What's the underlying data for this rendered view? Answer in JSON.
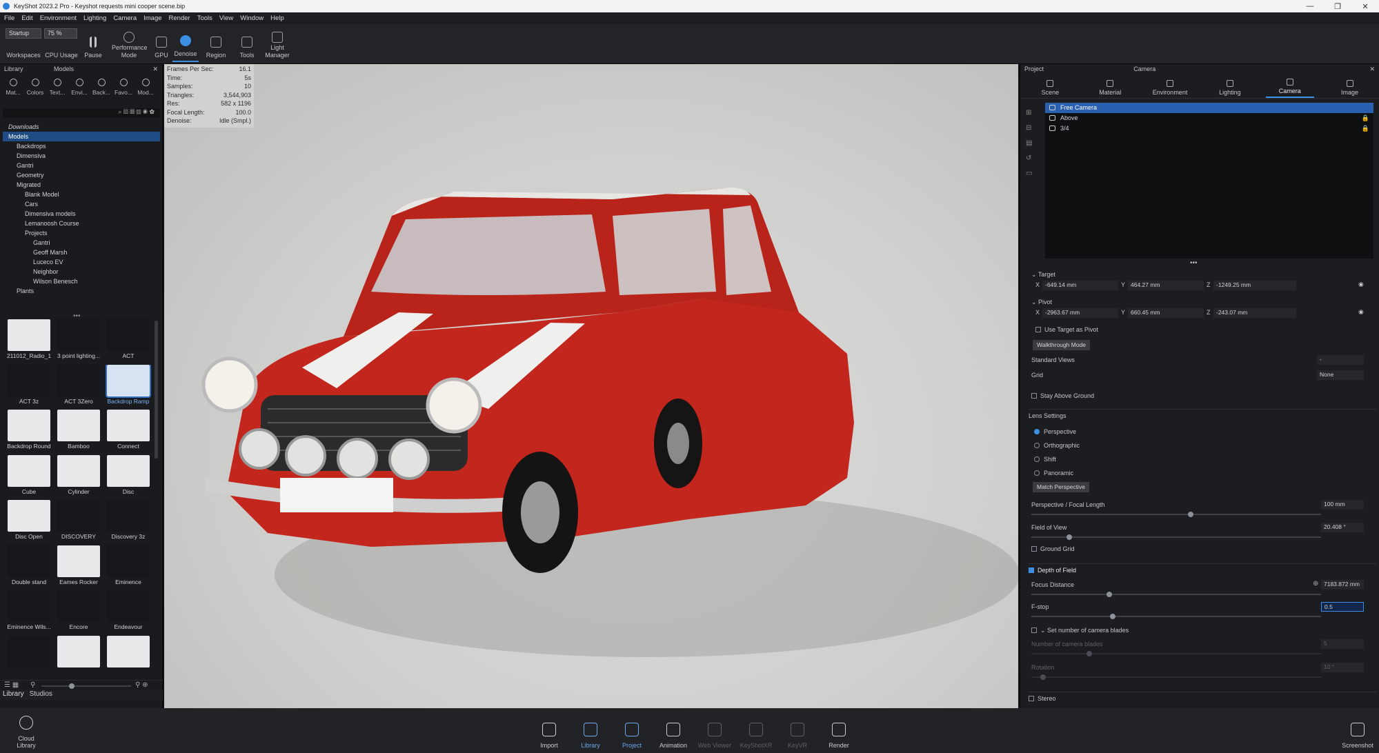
{
  "window": {
    "title": "KeyShot 2023.2 Pro - Keyshot requests mini cooper scene.bip",
    "min": "—",
    "max": "❐",
    "close": "✕"
  },
  "menu": [
    "File",
    "Edit",
    "Environment",
    "Lighting",
    "Camera",
    "Image",
    "Render",
    "Tools",
    "View",
    "Window",
    "Help"
  ],
  "toolbar": {
    "workspace_value": "Startup",
    "cpu_value": "75 %",
    "items": [
      "Workspaces",
      "CPU Usage",
      "Pause",
      "Performance Mode",
      "GPU",
      "Denoise",
      "Region",
      "Tools",
      "Light Manager"
    ]
  },
  "library": {
    "header_left": "Library",
    "header_center": "Models",
    "categories": [
      "Mat...",
      "Colors",
      "Text...",
      "Envi...",
      "Back...",
      "Favo...",
      "Mod..."
    ],
    "tree": [
      {
        "label": "Downloads",
        "indent": 0
      },
      {
        "label": "Models",
        "indent": 0,
        "hl": true
      },
      {
        "label": "Backdrops",
        "indent": 1
      },
      {
        "label": "Dimensiva",
        "indent": 1
      },
      {
        "label": "Gantri",
        "indent": 1
      },
      {
        "label": "Geometry",
        "indent": 1
      },
      {
        "label": "Migrated",
        "indent": 1
      },
      {
        "label": "Blank Model",
        "indent": 2
      },
      {
        "label": "Cars",
        "indent": 2
      },
      {
        "label": "Dimensiva models",
        "indent": 2
      },
      {
        "label": "Lemanoosh Course",
        "indent": 2
      },
      {
        "label": "Projects",
        "indent": 2
      },
      {
        "label": "Gantri",
        "indent": 3
      },
      {
        "label": "Geoff Marsh",
        "indent": 3
      },
      {
        "label": "Luceco EV",
        "indent": 3
      },
      {
        "label": "Neighbor",
        "indent": 3
      },
      {
        "label": "Wilson Benesch",
        "indent": 3
      },
      {
        "label": "Plants",
        "indent": 1
      }
    ],
    "thumbs": [
      "211012_Radio_1",
      "3 point lighting...",
      "ACT",
      "ACT 3z",
      "ACT 3Zero",
      "Backdrop Ramp",
      "Backdrop Round",
      "Bamboo",
      "Connect",
      "Cube",
      "Cylinder",
      "Disc",
      "Disc Open",
      "DISCOVERY",
      "Discovery 3z",
      "Double stand",
      "Eames Rocker",
      "Eminence",
      "Eminence Wils...",
      "Encore",
      "Endeavour",
      "",
      "",
      ""
    ],
    "bottom_tabs": [
      "Library",
      "Studios"
    ]
  },
  "stats": [
    [
      "Frames Per Sec:",
      "16.1"
    ],
    [
      "Time:",
      "5s"
    ],
    [
      "Samples:",
      "10"
    ],
    [
      "Triangles:",
      "3,544,903"
    ],
    [
      "Res:",
      "582 x 1196"
    ],
    [
      "Focal Length:",
      "100.0"
    ],
    [
      "Denoise:",
      "Idle (Smpl.)"
    ]
  ],
  "project": {
    "header_left": "Project",
    "header_center": "Camera",
    "tabs": [
      "Scene",
      "Material",
      "Environment",
      "Lighting",
      "Camera",
      "Image"
    ],
    "cameras": [
      "Free Camera",
      "Above",
      "3/4"
    ],
    "target": {
      "label": "Target",
      "x": "-649.14 mm",
      "y": "464.27 mm",
      "z": "-1249.25 mm"
    },
    "pivot": {
      "label": "Pivot",
      "x": "-2963.67 mm",
      "y": "660.45 mm",
      "z": "-243.07 mm"
    },
    "use_target_pivot": "Use Target as Pivot",
    "walkthrough": "Walkthrough Mode",
    "standard_views": "Standard Views",
    "standard_views_value": "-",
    "grid": "Grid",
    "grid_value": "None",
    "stay_above": "Stay Above Ground",
    "lens_settings": "Lens Settings",
    "lens": [
      "Perspective",
      "Orthographic",
      "Shift",
      "Panoramic"
    ],
    "match_perspective": "Match Perspective",
    "focal_label": "Perspective / Focal Length",
    "focal_value": "100 mm",
    "focal_level": 0.55,
    "fov_label": "Field of View",
    "fov_value": "20.408 °",
    "fov_level": 0.13,
    "ground_grid": "Ground Grid",
    "dof": "Depth of Field",
    "focus_label": "Focus Distance",
    "focus_value": "7183.872 mm",
    "focus_level": 0.27,
    "fstop_label": "F-stop",
    "fstop_value": "0.5",
    "fstop_level": 0.28,
    "blades_check": "Set number of camera blades",
    "blades_label": "Number of camera blades",
    "blades_value": "5",
    "blades_level": 0.2,
    "rotation_label": "Rotation",
    "rotation_value": "10 °",
    "rotation_level": 0.04,
    "stereo": "Stereo"
  },
  "bottom": {
    "cloud": "Cloud Library",
    "items": [
      "Import",
      "Library",
      "Project",
      "Animation",
      "Web Viewer",
      "KeyShotXR",
      "KeyVR",
      "Render"
    ],
    "screenshot": "Screenshot"
  },
  "colors": {
    "accent": "#3d8fe6",
    "car_red": "#c2261c"
  }
}
